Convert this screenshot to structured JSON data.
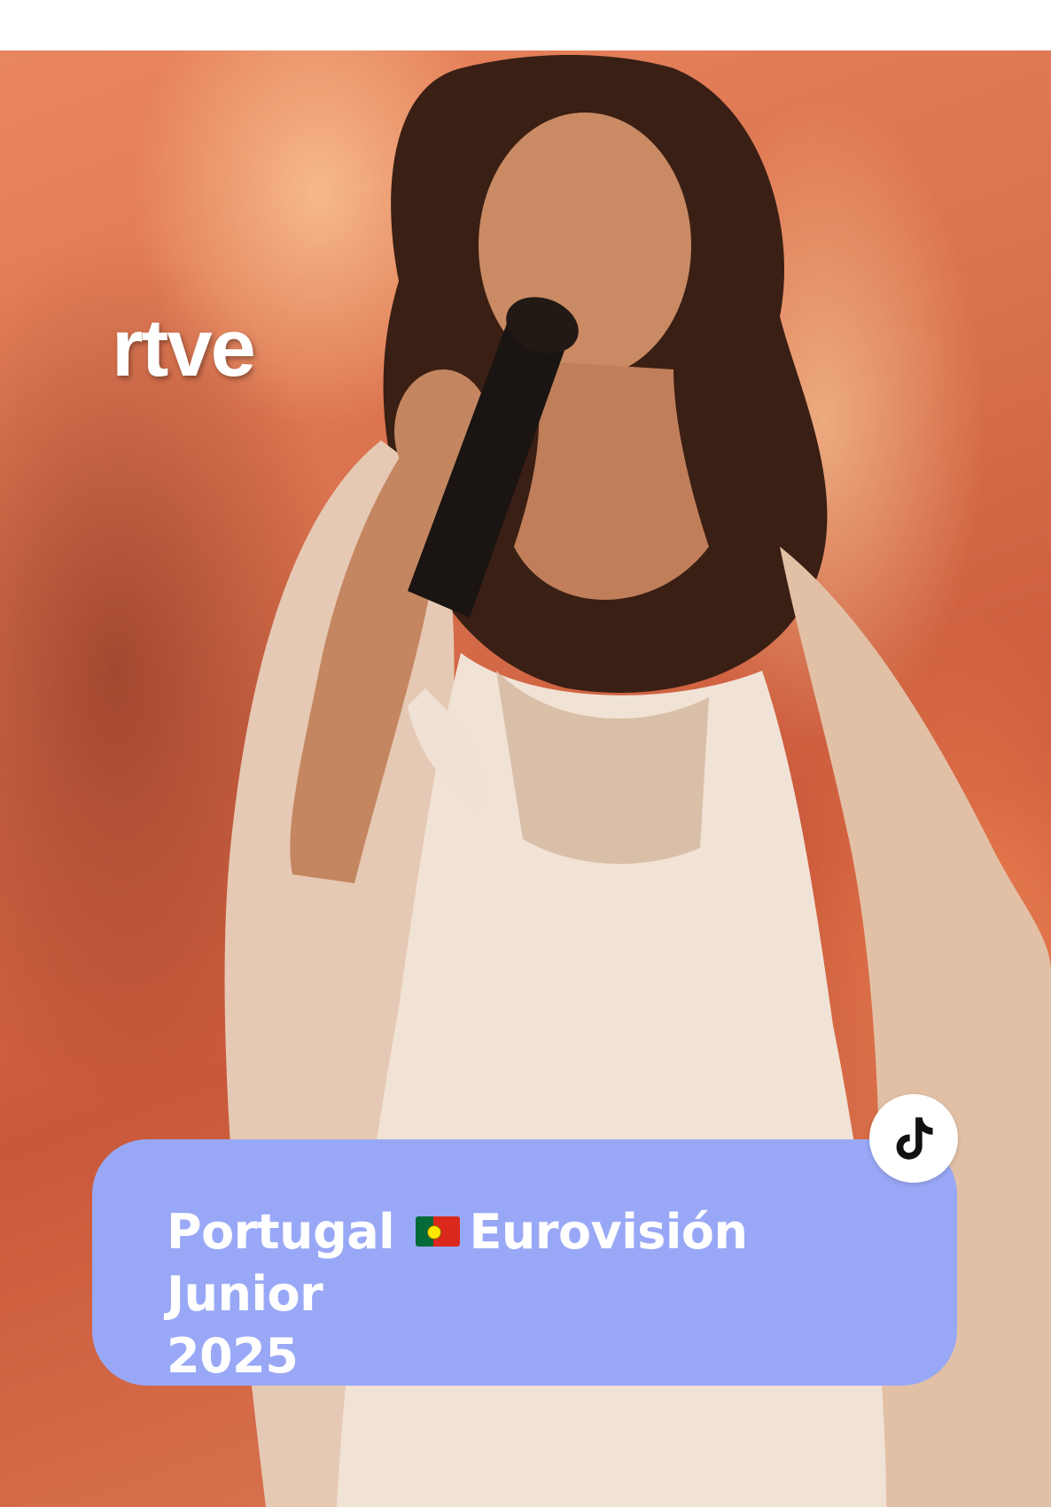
{
  "video": {
    "watermark": "rtve",
    "caption_line1": "Portugal",
    "caption_flag": "portugal-flag",
    "caption_rest": "Eurovisión Junior",
    "caption_line2": "2025",
    "platform_icon": "tiktok-icon"
  },
  "colors": {
    "caption_card": "#99a8f6",
    "caption_text": "#ffffff",
    "background_warm": "#d8704c"
  }
}
